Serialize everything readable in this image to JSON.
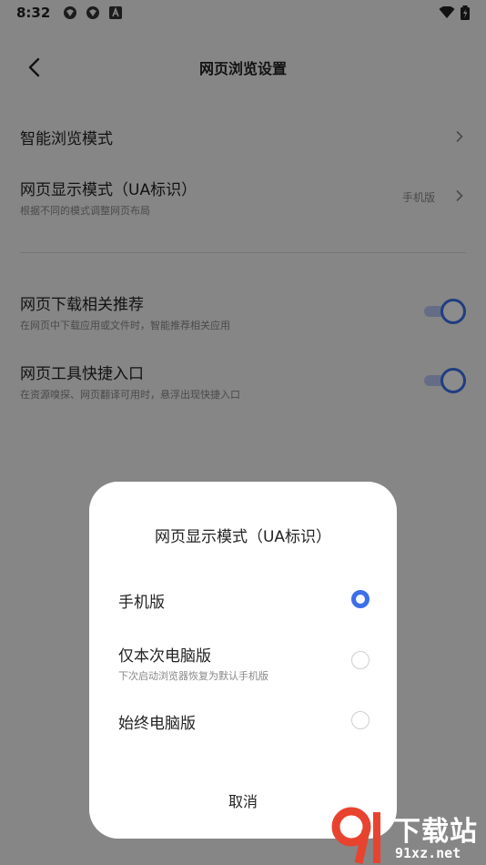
{
  "status_bar": {
    "time": "8:32"
  },
  "header": {
    "title": "网页浏览设置"
  },
  "settings": {
    "smart_browse": {
      "label": "智能浏览模式"
    },
    "ua_mode": {
      "label": "网页显示模式（UA标识）",
      "desc": "根据不同的模式调整网页布局",
      "value": "手机版"
    },
    "download_recommend": {
      "label": "网页下载相关推荐",
      "desc": "在网页中下载应用或文件时，智能推荐相关应用",
      "enabled": true
    },
    "tool_shortcut": {
      "label": "网页工具快捷入口",
      "desc": "在资源嗅探、网页翻译可用时，悬浮出现快捷入口",
      "enabled": true
    }
  },
  "dialog": {
    "title": "网页显示模式（UA标识）",
    "options": [
      {
        "label": "手机版",
        "desc": "",
        "selected": true
      },
      {
        "label": "仅本次电脑版",
        "desc": "下次启动浏览器恢复为默认手机版",
        "selected": false
      },
      {
        "label": "始终电脑版",
        "desc": "",
        "selected": false
      }
    ],
    "cancel_label": "取消"
  },
  "watermark": {
    "text": "下载站",
    "url": "91xz.net",
    "logo": "9"
  },
  "colors": {
    "accent": "#3d6fe9",
    "watermark": "#e8432f"
  }
}
